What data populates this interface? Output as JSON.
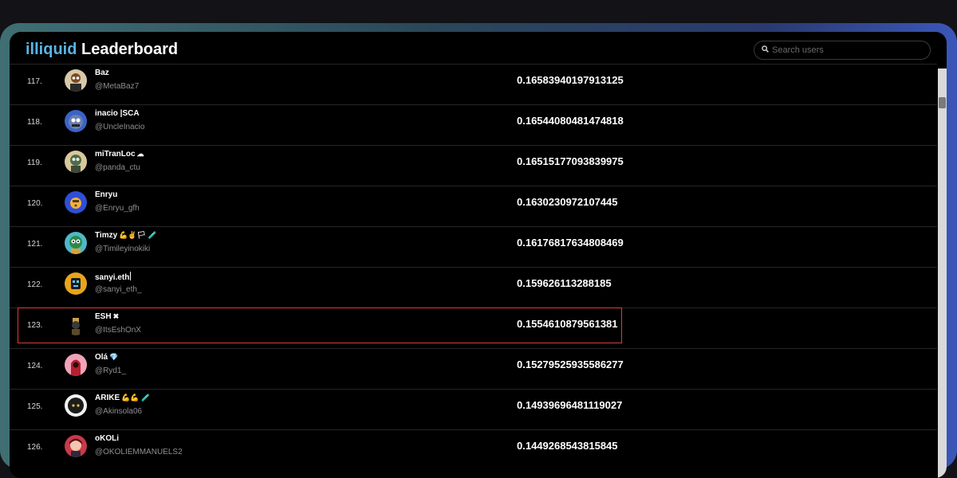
{
  "header": {
    "brand": "illiquid",
    "title": "Leaderboard",
    "search_placeholder": "Search users"
  },
  "rows": [
    {
      "rank": "117.",
      "name": "Baz",
      "handle": "@MetaBaz7",
      "score": "0.16583940197913125",
      "emoji": ""
    },
    {
      "rank": "118.",
      "name": "inacio |SCA",
      "handle": "@UncleInacio",
      "score": "0.16544080481474818",
      "emoji": ""
    },
    {
      "rank": "119.",
      "name": "miTranLoc",
      "handle": "@panda_ctu",
      "score": "0.16515177093839975",
      "emoji": "☁"
    },
    {
      "rank": "120.",
      "name": "Enryu",
      "handle": "@Enryu_gfh",
      "score": "0.1630230972107445",
      "emoji": ""
    },
    {
      "rank": "121.",
      "name": "Timzy",
      "handle": "@Timileyinokiki",
      "score": "0.16176817634808469",
      "emoji": "💪✌🏳 🧪"
    },
    {
      "rank": "122.",
      "name": "sanyi.eth",
      "handle": "@sanyi_eth_",
      "score": "0.159626113288185",
      "emoji": ""
    },
    {
      "rank": "123.",
      "name": "ESH",
      "handle": "@ItsEshOnX",
      "score": "0.1554610879561381",
      "emoji": "✖"
    },
    {
      "rank": "124.",
      "name": "Olá",
      "handle": "@Ryd1_",
      "score": "0.15279525935586277",
      "emoji": "💎"
    },
    {
      "rank": "125.",
      "name": "ARIKE",
      "handle": "@Akinsola06",
      "score": "0.14939696481119027",
      "emoji": "💪💪 🧪"
    },
    {
      "rank": "126.",
      "name": "oKOLi",
      "handle": "@OKOLIEMMANUELS2",
      "score": "0.1449268543815845",
      "emoji": ""
    }
  ],
  "colors": {
    "accent": "#5ab4e6",
    "highlight_border": "#e23b3b",
    "background": "#000000"
  }
}
